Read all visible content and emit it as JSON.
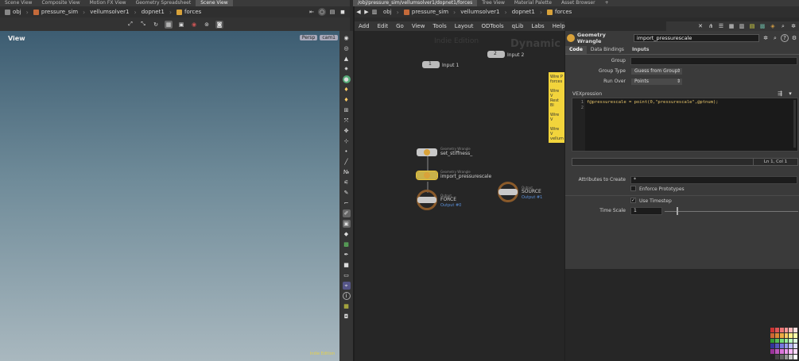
{
  "top_tabs_left": [
    "Scene View",
    "Composite View",
    "Motion FX View",
    "Geometry Spreadsheet",
    "Scene View"
  ],
  "top_tabs_right": [
    "/obj/pressure_sim/vellumsolver1/dopnet1/forces",
    "Tree View",
    "Material Palette",
    "Asset Browser"
  ],
  "left_path": {
    "obj": "obj",
    "items": [
      "pressure_sim",
      "vellumsolver1",
      "dopnet1",
      "forces"
    ]
  },
  "viewport": {
    "title": "View",
    "camera": "Persp",
    "cam_menu": "cam1",
    "watermark": "Indie Edition"
  },
  "right_path": {
    "obj": "obj",
    "items": [
      "pressure_sim",
      "vellumsolver1",
      "dopnet1",
      "forces"
    ]
  },
  "menu": [
    "Add",
    "Edit",
    "Go",
    "View",
    "Tools",
    "Layout",
    "ODTools",
    "qLib",
    "Labs",
    "Help"
  ],
  "network": {
    "watermark": "Indie Edition",
    "context_label": "Dynamic",
    "input1": "Input 1",
    "input2": "Input 2",
    "note_lines": [
      "Wire P",
      "forces",
      "Wire V",
      "Rest Bl",
      "Wire V",
      "Wire V",
      "vellum"
    ],
    "nodes": [
      {
        "type": "Geometry Wrangle",
        "name": "set_stiffness_"
      },
      {
        "type": "Geometry Wrangle",
        "name": "import_pressurescale"
      },
      {
        "type": "Output",
        "name": "FORCE",
        "sub": "Output #0"
      },
      {
        "type": "Output",
        "name": "SOURCE",
        "sub": "Output #1"
      }
    ]
  },
  "params": {
    "node_type": "Geometry Wrangle",
    "node_name": "import_pressurescale",
    "tabs": [
      "Code",
      "Data Bindings",
      "Inputs"
    ],
    "group_label": "Group",
    "group_value": "",
    "group_type_label": "Group Type",
    "group_type_value": "Guess from Group",
    "run_over_label": "Run Over",
    "run_over_value": "Points",
    "vex_label": "VEXpression",
    "code_line_numbers": [
      "1",
      "2"
    ],
    "code_line1": "f@pressurescale = point(0,\"pressurescale\",@ptnum);",
    "cursor_status": "Ln 1, Col 1",
    "attrs_label": "Attributes to Create",
    "attrs_value": "*",
    "enforce_label": "Enforce Prototypes",
    "use_timestep_label": "Use Timestep",
    "time_scale_label": "Time Scale",
    "time_scale_value": "1"
  },
  "colors": {
    "accent": "#e8c43a",
    "wrangle_node": "#c9b24a",
    "output_ring": "#8a5a2a",
    "note": "#f2d43c"
  }
}
